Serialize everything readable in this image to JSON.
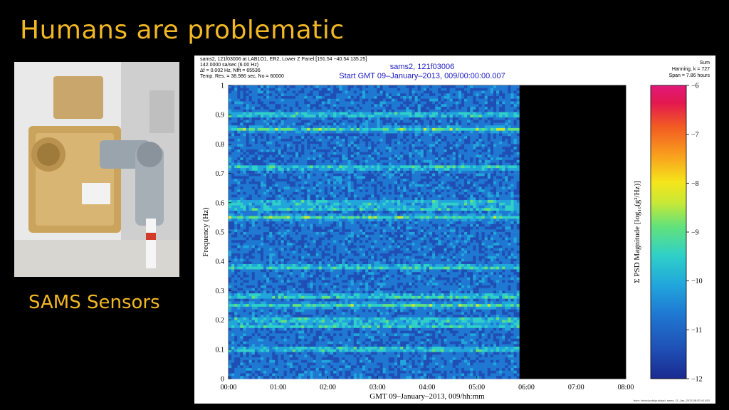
{
  "slide": {
    "title": "Humans are problematic",
    "caption": "SAMS Sensors",
    "accent_color": "#f2b824",
    "background_color": "#000000"
  },
  "photo": {
    "subject": "SAMS sensor hardware (gold/brass box with cable connectors)"
  },
  "figure": {
    "header_left": [
      "sams2, 121f03006 at LAB1O1, ER2, Lower Z Panel:[191.54 −40.54 135.25]",
      "142.0000 sa/sec (6.00 Hz)",
      "Δf = 0.002 Hz,  Nfft = 65536",
      "Temp. Res. = 38.986 sec, No = 60000"
    ],
    "header_center": [
      "sams2, 121f03006",
      "Start GMT 09–January–2013, 009/00:00:00.007"
    ],
    "header_right": [
      "Sum",
      "Hanning, k = 727",
      "Span = 7.86 hours"
    ],
    "footer_note": "from: /misc/yoda/pub/pad, sams, 11–Jan–2013,08:02:41.810"
  },
  "chart_data": {
    "type": "heatmap",
    "title": "sams2, 121f03006",
    "subtitle": "Start GMT 09–January–2013, 009/00:00:00.007",
    "xlabel": "GMT 09–January–2013, 009/hh:mm",
    "ylabel": "Frequency (Hz)",
    "x_ticks": [
      "00:00",
      "01:00",
      "02:00",
      "03:00",
      "04:00",
      "05:00",
      "06:00",
      "07:00",
      "08:00"
    ],
    "x_range_hours": [
      0,
      8
    ],
    "y_ticks": [
      "0",
      "0.1",
      "0.2",
      "0.3",
      "0.4",
      "0.5",
      "0.6",
      "0.7",
      "0.8",
      "0.9",
      "1"
    ],
    "ylim": [
      0,
      1
    ],
    "data_end_hours": 5.86,
    "colorbar": {
      "label": "Σ PSD Magnitude [log₁₀(g²/Hz)]",
      "ticks": [
        "−6",
        "−7",
        "−8",
        "−9",
        "−10",
        "−11",
        "−12"
      ],
      "range": [
        -12,
        -6
      ],
      "colormap": [
        "#1a2a90",
        "#1f4fb5",
        "#1f78d2",
        "#21a6dc",
        "#2fd0c8",
        "#63e27a",
        "#c8e836",
        "#f5e51b",
        "#f9a01d",
        "#f25a22",
        "#e3184f",
        "#e2187b"
      ]
    },
    "bands_hz": [
      0.1,
      0.18,
      0.2,
      0.25,
      0.28,
      0.38,
      0.55,
      0.58,
      0.6,
      0.72,
      0.85,
      0.9
    ],
    "background_level": -11.3,
    "peak_level": -9.8
  }
}
